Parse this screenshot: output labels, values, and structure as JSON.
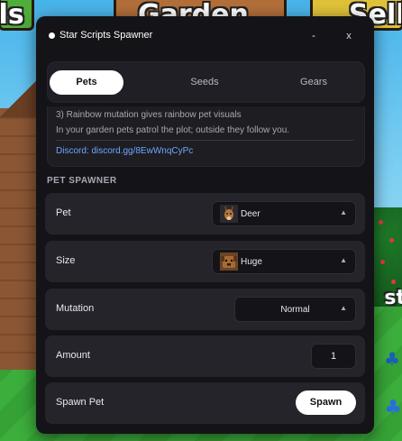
{
  "background": {
    "sign_left": "eds",
    "sign_center": "Garden",
    "sign_right": "Sell",
    "sign_side": "st"
  },
  "window": {
    "title": "Star Scripts Spawner",
    "minimize_label": "-",
    "close_label": "x"
  },
  "tabs": [
    {
      "label": "Pets",
      "active": true
    },
    {
      "label": "Seeds",
      "active": false
    },
    {
      "label": "Gears",
      "active": false
    }
  ],
  "info": {
    "line1": "3) Rainbow mutation gives rainbow pet visuals",
    "line2": "In your garden pets patrol the plot; outside they follow you.",
    "discord": "Discord: discord.gg/8EwWnqCyPc"
  },
  "section_title": "PET SPAWNER",
  "pet": {
    "label": "Pet",
    "value": "Deer",
    "icon": "deer-icon"
  },
  "size": {
    "label": "Size",
    "value": "Huge",
    "icon": "dog-icon"
  },
  "mutation": {
    "label": "Mutation",
    "value": "Normal"
  },
  "amount": {
    "label": "Amount",
    "value": "1"
  },
  "spawn": {
    "label": "Spawn Pet",
    "button": "Spawn"
  },
  "colors": {
    "window_bg": "#141418",
    "row_bg": "#24242a",
    "link": "#6ea6ff",
    "accent_button": "#ffffff"
  }
}
